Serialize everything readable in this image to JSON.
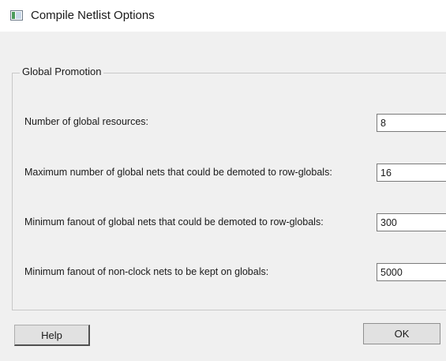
{
  "window": {
    "title": "Compile Netlist Options"
  },
  "group": {
    "legend": "Global Promotion"
  },
  "rows": [
    {
      "label": "Number of global resources:",
      "value": "8"
    },
    {
      "label": "Maximum number of global nets that could be demoted to row-globals:",
      "value": "16"
    },
    {
      "label": "Minimum fanout of global nets that could be demoted to row-globals:",
      "value": "300"
    },
    {
      "label": "Minimum fanout of non-clock nets to be kept on globals:",
      "value": "5000"
    }
  ],
  "buttons": {
    "help": "Help",
    "ok": "OK"
  }
}
